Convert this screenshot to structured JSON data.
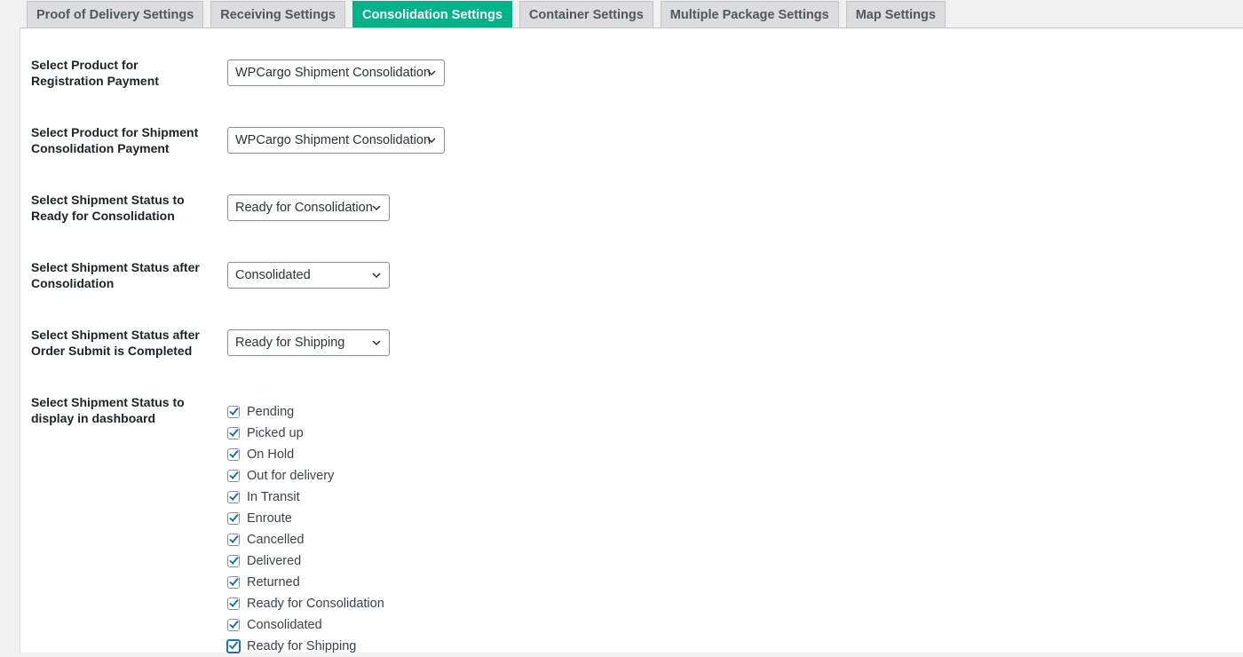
{
  "tabs": [
    {
      "label": "Proof of Delivery Settings",
      "active": false
    },
    {
      "label": "Receiving Settings",
      "active": false
    },
    {
      "label": "Consolidation Settings",
      "active": true
    },
    {
      "label": "Container Settings",
      "active": false
    },
    {
      "label": "Multiple Package Settings",
      "active": false
    },
    {
      "label": "Map Settings",
      "active": false
    }
  ],
  "settings": {
    "registration_product": {
      "label": "Select Product for Registration Payment",
      "value": "WPCargo Shipment Consolidation"
    },
    "consolidation_product": {
      "label": "Select Product for Shipment Consolidation Payment",
      "value": "WPCargo Shipment Consolidation"
    },
    "ready_status": {
      "label": "Select Shipment Status to Ready for Consolidation",
      "value": "Ready for Consolidation"
    },
    "after_consolidation_status": {
      "label": "Select Shipment Status after Consolidation",
      "value": "Consolidated"
    },
    "after_order_status": {
      "label": "Select Shipment Status after Order Submit is Completed",
      "value": "Ready for Shipping"
    },
    "dashboard_status": {
      "label": "Select Shipment Status to display in dashboard",
      "options": [
        {
          "label": "Pending",
          "checked": true
        },
        {
          "label": "Picked up",
          "checked": true
        },
        {
          "label": "On Hold",
          "checked": true
        },
        {
          "label": "Out for delivery",
          "checked": true
        },
        {
          "label": "In Transit",
          "checked": true
        },
        {
          "label": "Enroute",
          "checked": true
        },
        {
          "label": "Cancelled",
          "checked": true
        },
        {
          "label": "Delivered",
          "checked": true
        },
        {
          "label": "Returned",
          "checked": true
        },
        {
          "label": "Ready for Consolidation",
          "checked": true
        },
        {
          "label": "Consolidated",
          "checked": true
        },
        {
          "label": "Ready for Shipping",
          "checked": true
        }
      ]
    }
  },
  "colors": {
    "accent": "#00b288",
    "checkmark": "#2271b1",
    "focus": "#2271b1"
  }
}
